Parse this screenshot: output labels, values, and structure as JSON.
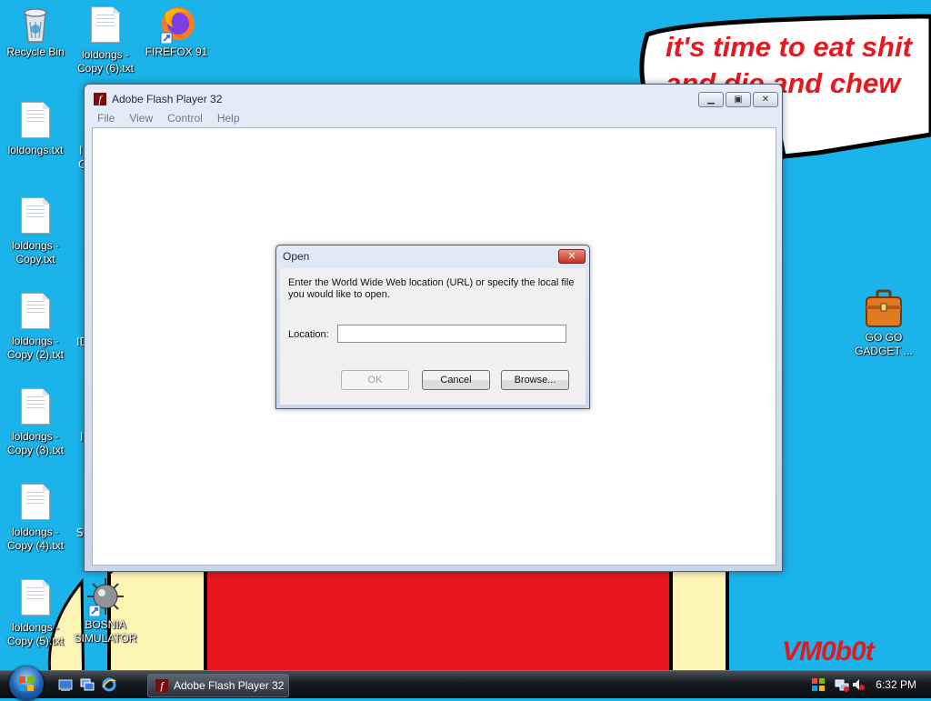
{
  "desktop": {
    "icons": [
      {
        "label": "Recycle Bin"
      },
      {
        "label": "loldongs - Copy (6).txt"
      },
      {
        "label": "FIREFOX 91"
      },
      {
        "label": "loldongs.txt"
      },
      {
        "label": "loldongs - Copy.txt"
      },
      {
        "label": "loldongs - Copy (2).txt"
      },
      {
        "label": "loldongs - Copy (3).txt"
      },
      {
        "label": "loldongs - Copy (4).txt"
      },
      {
        "label": "loldongs - Copy (5).txt"
      },
      {
        "label": "BOSNIA SIMULATOR"
      },
      {
        "label": "GO GO GADGET ..."
      }
    ],
    "partial_labels": [
      "l",
      "C",
      "ID",
      "l",
      "S"
    ]
  },
  "wallpaper": {
    "speech_bubble": "it's time to eat shit\nand die and chew\ngum",
    "signature": "VM0b0t",
    "colors": {
      "sky": "#1ab3ea",
      "red": "#e8161e",
      "yellow": "#fdf5b4"
    }
  },
  "flash_window": {
    "title": "Adobe Flash Player 32",
    "menu": [
      "File",
      "View",
      "Control",
      "Help"
    ]
  },
  "open_dialog": {
    "title": "Open",
    "message": "Enter the World Wide Web location (URL) or specify the local file you would like to open.",
    "location_label": "Location:",
    "location_value": "",
    "ok_label": "OK",
    "cancel_label": "Cancel",
    "browse_label": "Browse..."
  },
  "taskbar": {
    "task_button_label": "Adobe Flash Player 32",
    "clock": "6:32 PM"
  }
}
